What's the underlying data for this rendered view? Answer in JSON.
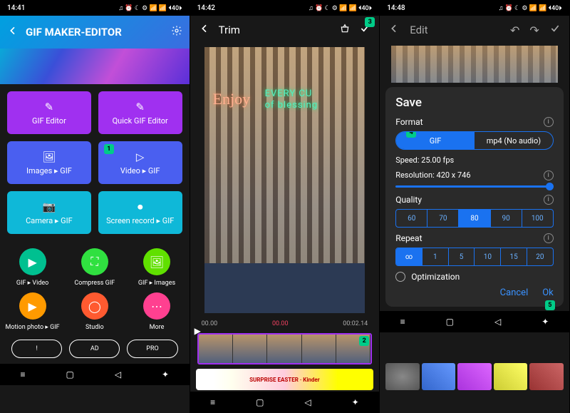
{
  "status": {
    "t1": "14:41",
    "t2": "14:42",
    "t3": "14:48",
    "icons": "♫ ⏰ ☾ ⚙ 📶 📶 ⏴40⏵"
  },
  "s1": {
    "title": "GIF MAKER-EDITOR",
    "tiles": [
      {
        "label": "GIF Editor"
      },
      {
        "label": "Quick GIF Editor"
      },
      {
        "label": "Images ▸ GIF"
      },
      {
        "label": "Video ▸ GIF",
        "badge": "1"
      },
      {
        "label": "Camera ▸ GIF"
      },
      {
        "label": "Screen record ▸ GIF"
      }
    ],
    "circles": [
      {
        "label": "GIF ▸ Video",
        "color": "#00c090"
      },
      {
        "label": "Compress GIF",
        "color": "#30e040"
      },
      {
        "label": "GIF ▸ Images",
        "color": "#60e000"
      },
      {
        "label": "Motion photo ▸ GIF",
        "color": "#ff9a00"
      },
      {
        "label": "Studio",
        "color": "#ff5a30"
      },
      {
        "label": "More",
        "color": "#ff4090"
      }
    ],
    "pills": [
      "!",
      "AD",
      "PRO"
    ]
  },
  "s2": {
    "title": "Trim",
    "topbadge": "3",
    "neon1": "Enjoy",
    "neon2a": "EVERY CU",
    "neon2b": "of blessing",
    "time_start": "00.00",
    "time_mid": "00.00",
    "time_end": "00:02.14",
    "strip_badge": "2",
    "ad": "SURPRISE EASTER · Kinder"
  },
  "s3": {
    "title": "Edit",
    "save": "Save",
    "format_lbl": "Format",
    "format_gif": "GIF",
    "format_mp4": "mp4 (No audio)",
    "format_badge": "4",
    "speed_lbl": "Speed",
    "speed_val": ": 25.00 fps",
    "res_lbl": "Resolution",
    "res_val": ": 420 x 746",
    "quality_lbl": "Quality",
    "quality_opts": [
      "60",
      "70",
      "80",
      "90",
      "100"
    ],
    "quality_sel": "80",
    "repeat_lbl": "Repeat",
    "repeat_opts": [
      "∞",
      "1",
      "5",
      "10",
      "15",
      "20"
    ],
    "repeat_sel": "∞",
    "optim": "Optimization",
    "cancel": "Cancel",
    "ok": "Ok",
    "okbadge": "5"
  }
}
